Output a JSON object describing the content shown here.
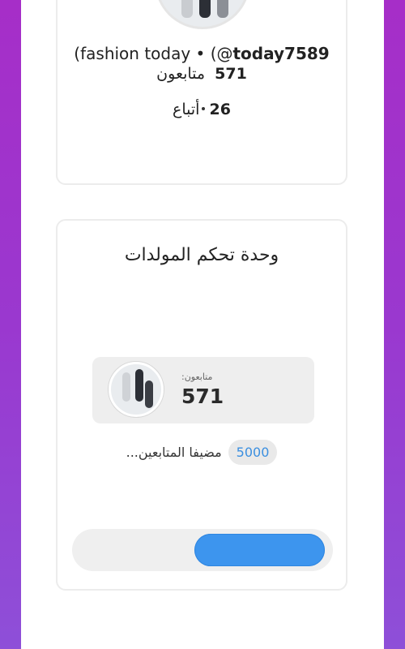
{
  "profile": {
    "display_name": "(fashion today • (@",
    "username": "today7589",
    "followers_count": "571",
    "followers_label": "متابعون",
    "following_count": "26",
    "following_label": "أتباع"
  },
  "generator": {
    "title": "وحدة تحكم المولدات",
    "panel_label": "متابعون:",
    "panel_count": "571",
    "adding_text": "مضيفا المتابعين...",
    "target_badge": "5000",
    "progress": {
      "fraction": 0.52,
      "fill_color": "#3d95ee"
    }
  },
  "colors": {
    "background_top": "#a62ec8",
    "background_bottom": "#8e4fd8",
    "accent": "#3d95ee"
  }
}
